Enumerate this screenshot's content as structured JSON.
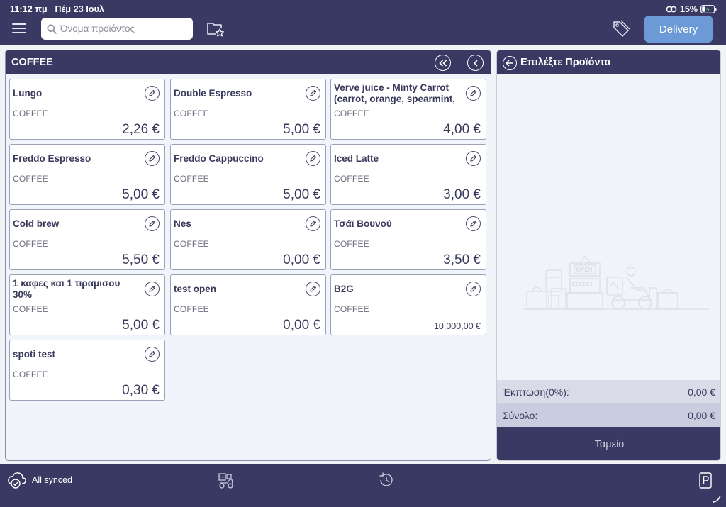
{
  "status_bar": {
    "time": "11:12 πμ",
    "date": "Πέμ 23 Ιουλ",
    "battery": "15%"
  },
  "toolbar": {
    "menu_icon": "hamburger-menu-icon",
    "search_placeholder": "Όνομα προϊόντος",
    "delivery_label": "Delivery"
  },
  "category": {
    "title": "COFFEE"
  },
  "products": [
    {
      "name": "Lungo",
      "category": "COFFEE",
      "price": "2,26 €"
    },
    {
      "name": "Double Espresso",
      "category": "COFFEE",
      "price": "5,00 €"
    },
    {
      "name": "Verve juice - Minty Carrot (carrot, orange, spearmint,",
      "category": "COFFEE",
      "price": "4,00 €"
    },
    {
      "name": "Freddo Espresso",
      "category": "COFFEE",
      "price": "5,00 €"
    },
    {
      "name": "Freddo Cappuccino",
      "category": "COFFEE",
      "price": "5,00 €"
    },
    {
      "name": "Iced Latte",
      "category": "COFFEE",
      "price": "3,00 €"
    },
    {
      "name": "Cold brew",
      "category": "COFFEE",
      "price": "5,50 €"
    },
    {
      "name": "Nes",
      "category": "COFFEE",
      "price": "0,00 €"
    },
    {
      "name": "Τσάϊ Βουνού",
      "category": "COFFEE",
      "price": "3,50 €"
    },
    {
      "name": "1 καφες και 1 τιραμισου 30%",
      "category": "COFFEE",
      "price": "5,00 €"
    },
    {
      "name": "test open",
      "category": "COFFEE",
      "price": "0,00 €"
    },
    {
      "name": "B2G",
      "category": "COFFEE",
      "price": "10.000,00 €"
    },
    {
      "name": "spoti test",
      "category": "COFFEE",
      "price": "0,30 €"
    }
  ],
  "order": {
    "title": "Επιλέξτε Προϊόντα",
    "discount_label": "Έκπτωση(0%):",
    "discount_value": "0,00 €",
    "total_label": "Σύνολο:",
    "total_value": "0,00 €",
    "checkout_label": "Ταμείο"
  },
  "footer": {
    "sync_label": "All synced"
  },
  "colors": {
    "nav_bg": "#393963",
    "accent": "#6b9ad6",
    "panel_bg": "#f1f4fa"
  }
}
